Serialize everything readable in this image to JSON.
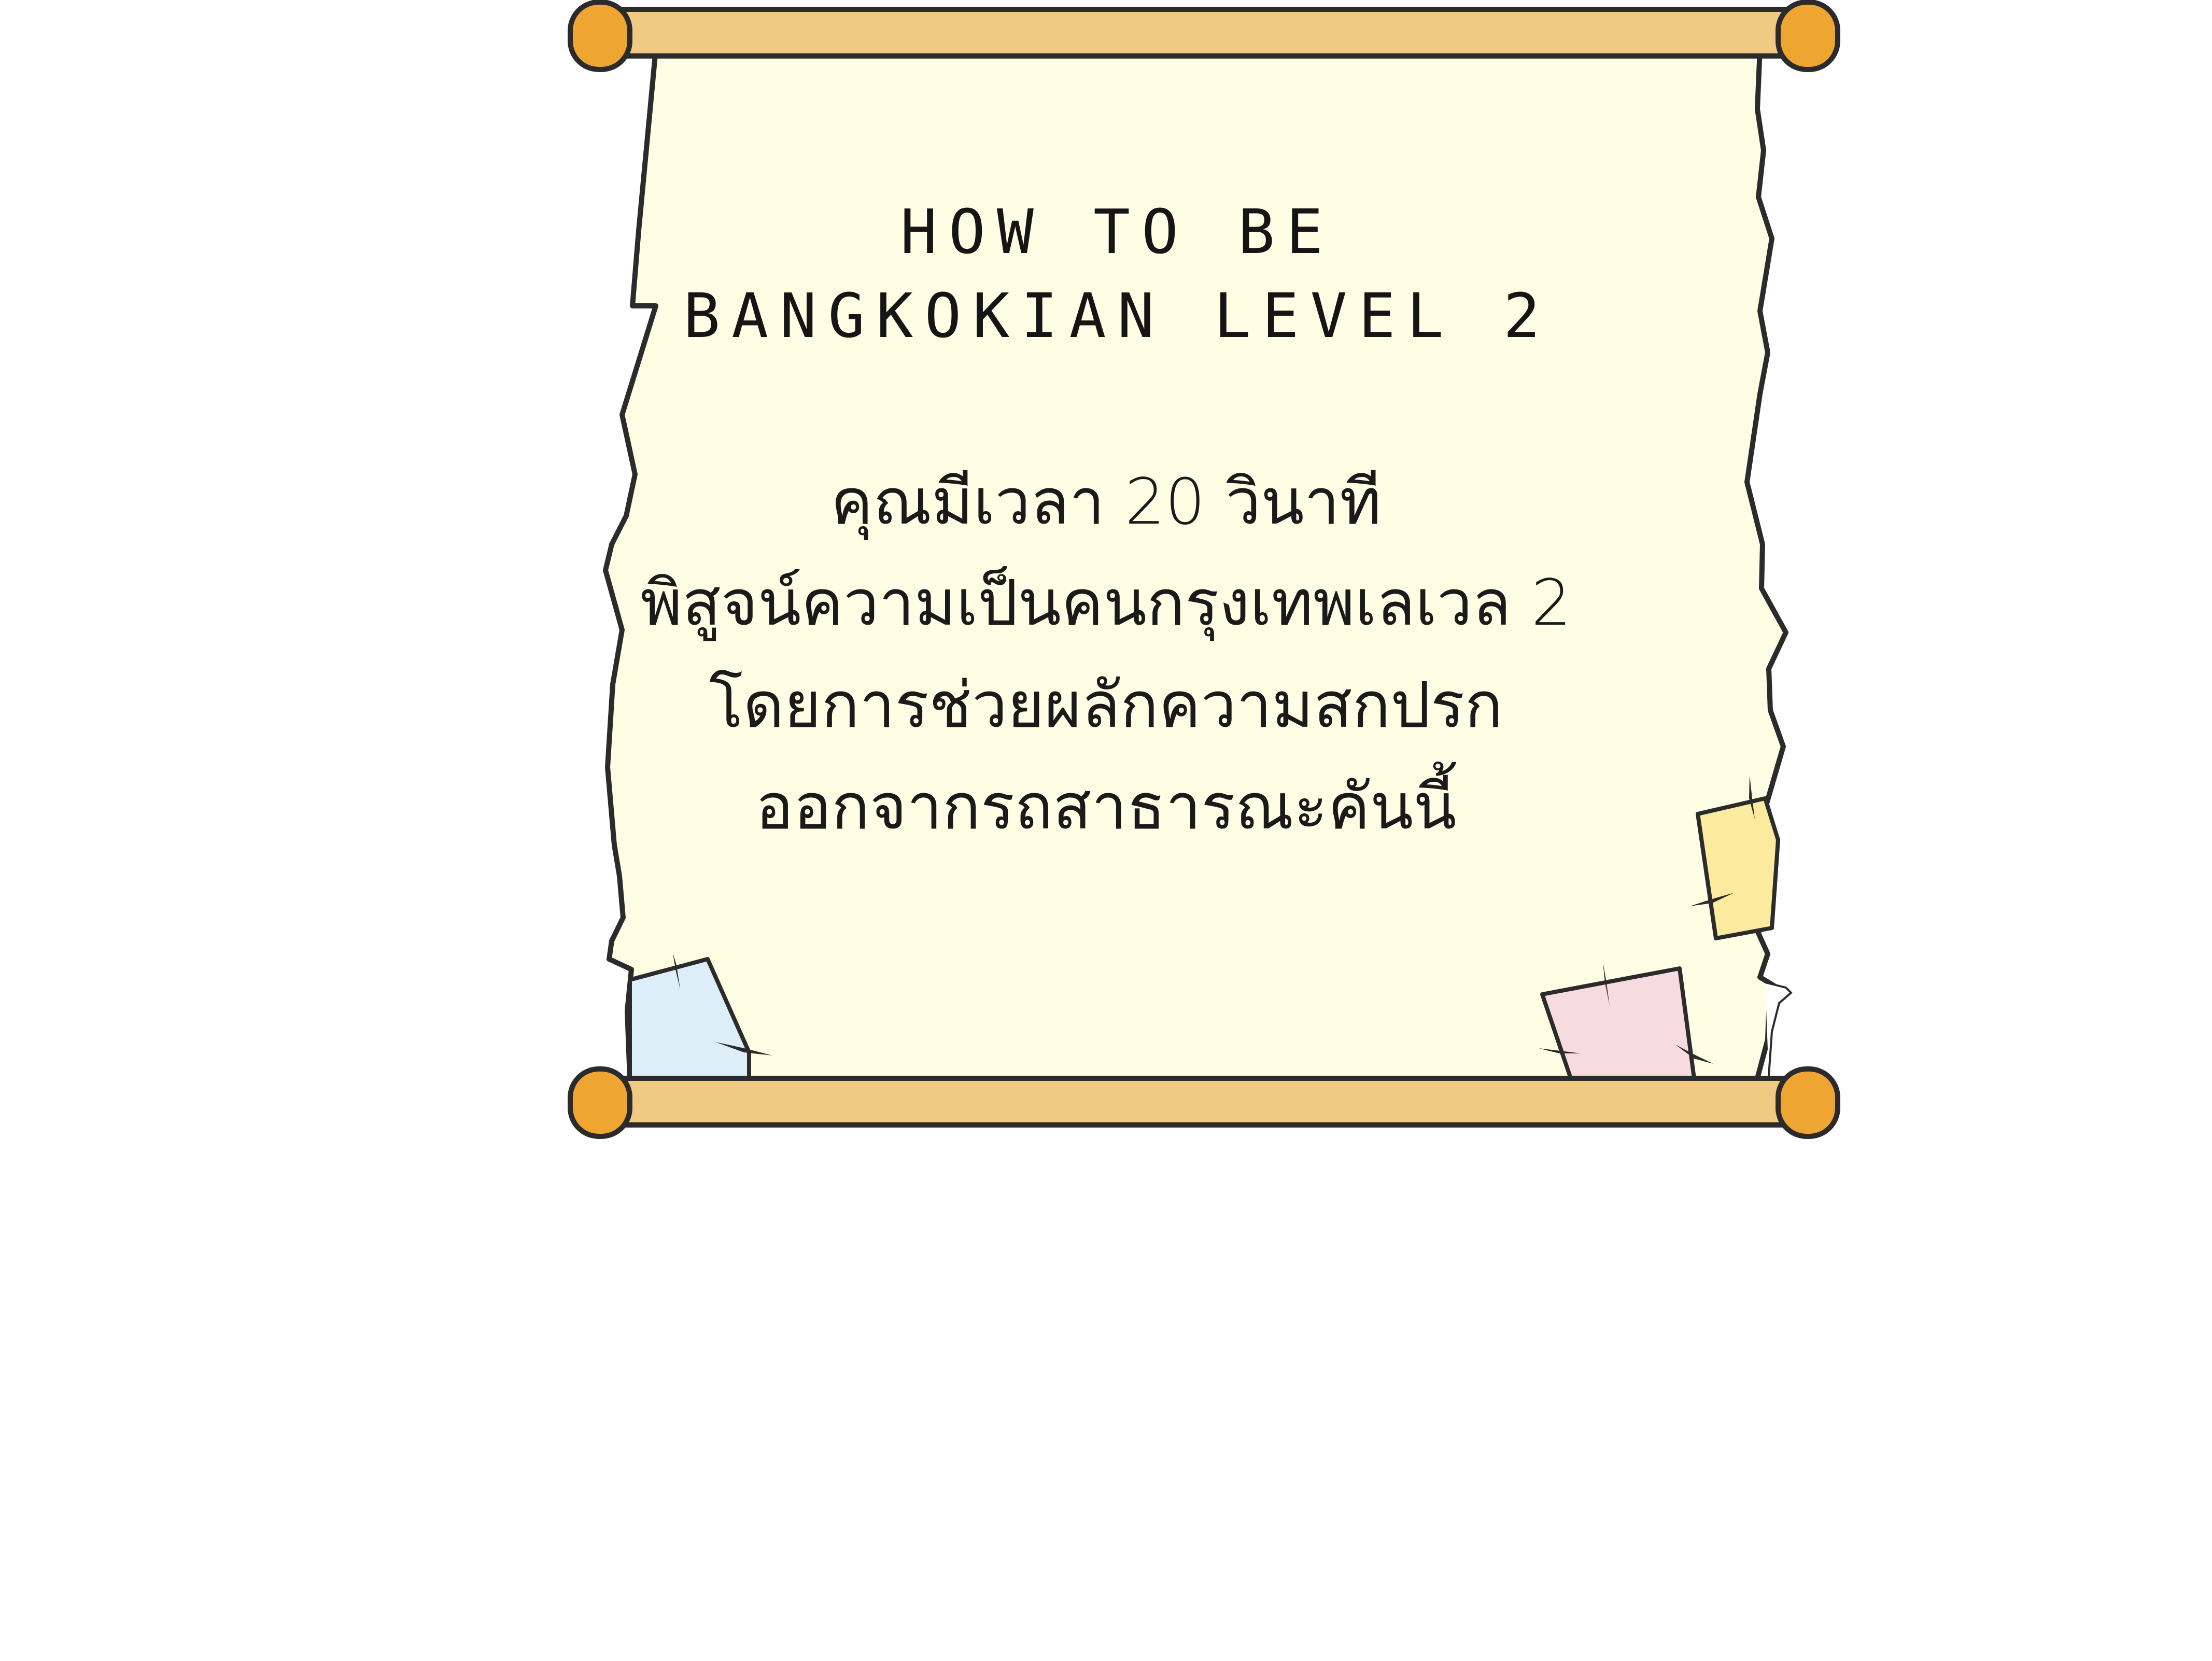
{
  "scroll": {
    "title_lines": [
      "HOW TO BE",
      "BANGKOKIAN LEVEL 2"
    ],
    "body_lines": [
      "คุณมีเวลา 20 วินาที",
      "พิสูจน์ความเป็นคนกรุงเทพเลเวล 2",
      "โดยการช่วยผลักความสกปรก",
      "ออกจากรถสาธารณะคันนี้"
    ]
  },
  "colors": {
    "parchment": "#fefee4",
    "outline": "#2b2b2b",
    "rod": "#f0ca82",
    "rod_cap": "#eea532",
    "note_blue": "#ddeef8",
    "note_pink": "#f6dcde",
    "note_yellow": "#fcea9e"
  }
}
